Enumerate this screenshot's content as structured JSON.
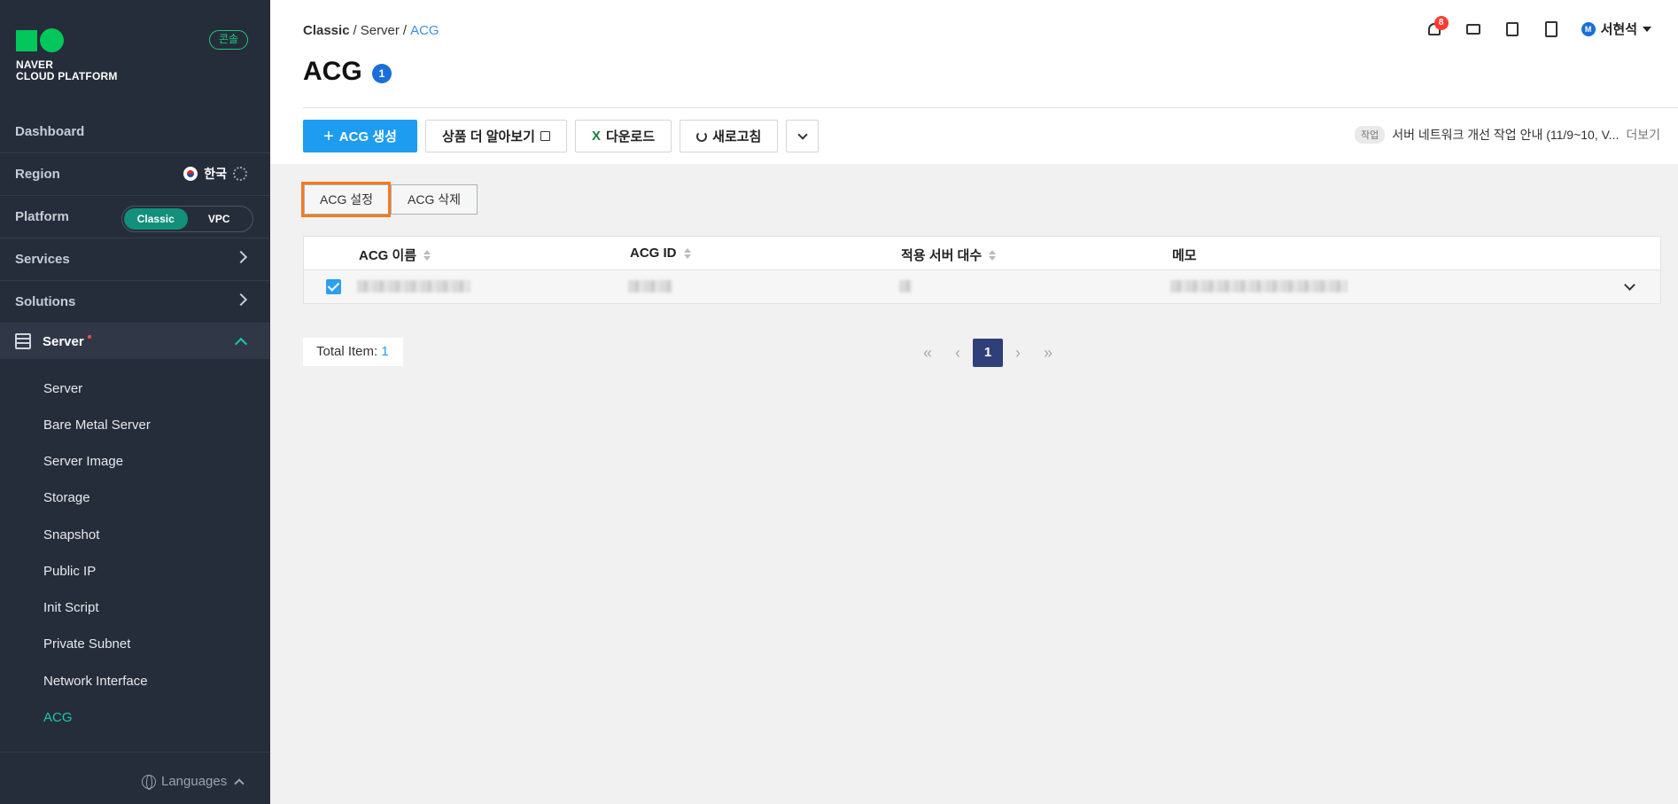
{
  "sidebar": {
    "logo_line1": "NAVER",
    "logo_line2": "CLOUD PLATFORM",
    "console_badge": "콘솔",
    "dashboard": "Dashboard",
    "region_label": "Region",
    "region_value": "한국",
    "platform_label": "Platform",
    "platform_options": [
      "Classic",
      "VPC"
    ],
    "platform_selected": "Classic",
    "services": "Services",
    "solutions": "Solutions",
    "server_group": "Server",
    "items": [
      "Server",
      "Bare Metal Server",
      "Server Image",
      "Storage",
      "Snapshot",
      "Public IP",
      "Init Script",
      "Private Subnet",
      "Network Interface",
      "ACG"
    ],
    "active_item": "ACG",
    "languages": "Languages"
  },
  "header": {
    "breadcrumb": [
      "Classic",
      "Server",
      "ACG"
    ],
    "title": "ACG",
    "count": "1",
    "notification_count": "8",
    "user_initial": "M",
    "user_name": "서현석"
  },
  "toolbar": {
    "create": "ACG 생성",
    "learn_more": "상품 더 알아보기",
    "download": "다운로드",
    "refresh": "새로고침"
  },
  "notice": {
    "tag": "작업",
    "text": "서버 네트워크 개선 작업 안내 (11/9~10, V...",
    "more": "더보기"
  },
  "actions": {
    "settings": "ACG 설정",
    "delete": "ACG 삭제"
  },
  "table": {
    "columns": [
      "ACG 이름",
      "ACG ID",
      "적용 서버 대수",
      "메모"
    ]
  },
  "footer": {
    "total_label": "Total Item:",
    "total_value": "1",
    "current_page": "1"
  },
  "colors": {
    "primary": "#1e9cf0",
    "highlight": "#f47b20",
    "sidebar_bg": "#262d3a",
    "active_teal": "#18c8b0"
  }
}
